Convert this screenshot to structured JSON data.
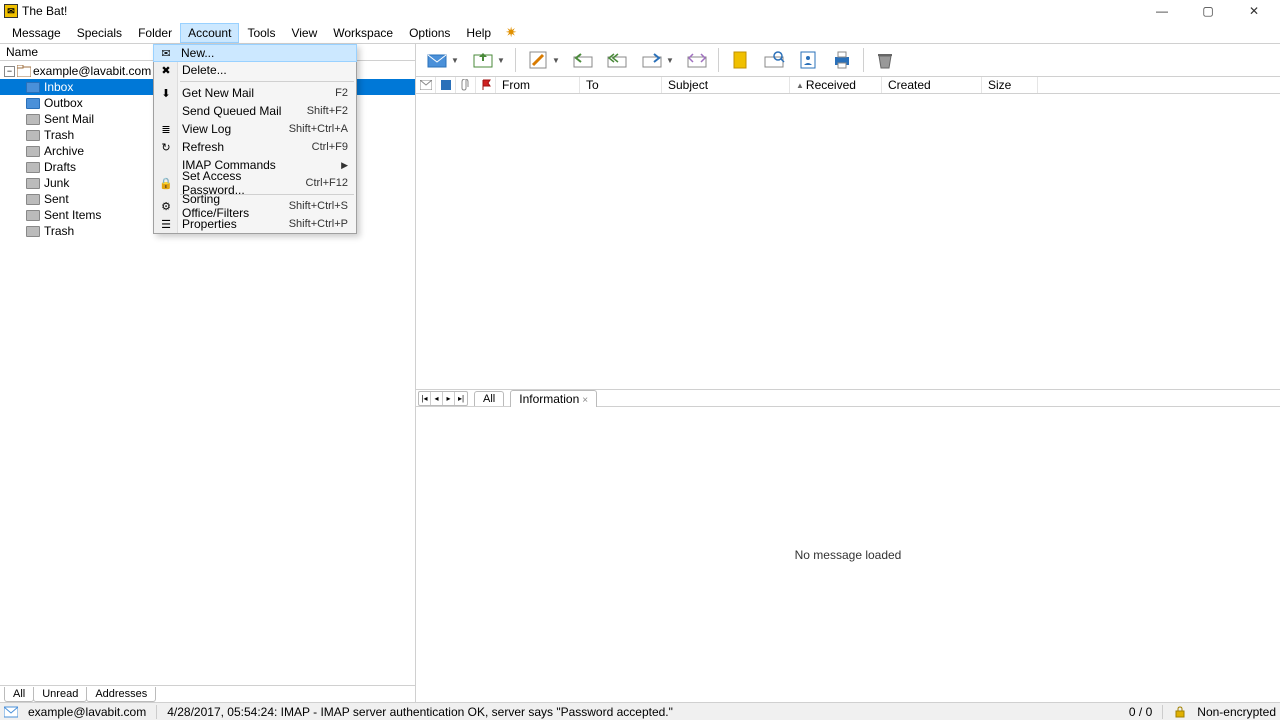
{
  "title": "The Bat!",
  "menubar": [
    "Message",
    "Specials",
    "Folder",
    "Account",
    "Tools",
    "View",
    "Workspace",
    "Options",
    "Help"
  ],
  "active_menu_index": 3,
  "sidebar": {
    "header": "Name",
    "account": "example@lavabit.com",
    "folders": [
      "Inbox",
      "Outbox",
      "Sent Mail",
      "Trash",
      "Archive",
      "Drafts",
      "Junk",
      "Sent",
      "Sent Items",
      "Trash"
    ],
    "selected_index": 0,
    "tabs": [
      "All",
      "Unread",
      "Addresses"
    ]
  },
  "columns": {
    "from": "From",
    "to": "To",
    "subject": "Subject",
    "received": "Received",
    "created": "Created",
    "size": "Size"
  },
  "preview_tabs": {
    "all": "All",
    "info": "Information"
  },
  "preview_empty": "No message loaded",
  "dropdown": {
    "items": [
      {
        "label": "New...",
        "shortcut": "",
        "icon": "new",
        "highlight": true
      },
      {
        "label": "Delete...",
        "shortcut": "",
        "icon": "delete"
      },
      {
        "sep": true
      },
      {
        "label": "Get New Mail",
        "shortcut": "F2",
        "icon": "get"
      },
      {
        "label": "Send Queued Mail",
        "shortcut": "Shift+F2",
        "icon": ""
      },
      {
        "label": "View Log",
        "shortcut": "Shift+Ctrl+A",
        "icon": "log"
      },
      {
        "label": "Refresh",
        "shortcut": "Ctrl+F9",
        "icon": "refresh"
      },
      {
        "label": "IMAP Commands",
        "shortcut": "",
        "icon": "",
        "sub": true
      },
      {
        "label": "Set Access Password...",
        "shortcut": "Ctrl+F12",
        "icon": "lock"
      },
      {
        "sep": true
      },
      {
        "label": "Sorting Office/Filters",
        "shortcut": "Shift+Ctrl+S",
        "icon": "filters"
      },
      {
        "label": "Properties",
        "shortcut": "Shift+Ctrl+P",
        "icon": "props"
      }
    ]
  },
  "statusbar": {
    "account": "example@lavabit.com",
    "log": "4/28/2017, 05:54:24: IMAP  - IMAP server authentication OK, server says \"Password accepted.\"",
    "counter": "0 / 0",
    "encryption": "Non-encrypted"
  }
}
